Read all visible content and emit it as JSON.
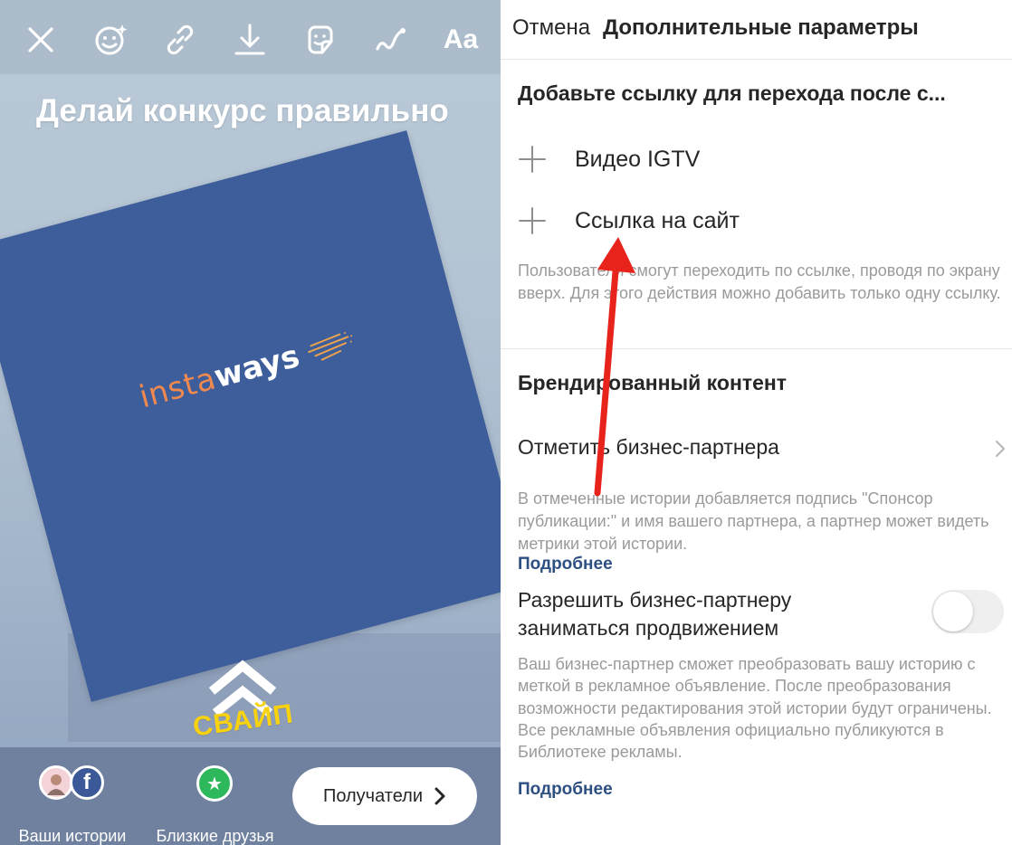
{
  "story": {
    "toolbar": {
      "close_icon": "close-icon",
      "face_effects_icon": "face-effects-icon",
      "link_icon": "link-icon",
      "download_icon": "download-icon",
      "sticker_icon": "sticker-icon",
      "draw_icon": "draw-icon",
      "text_tool_label": "Aa"
    },
    "heading": "Делай конкурс правильно",
    "logo": {
      "part1": "insta",
      "part2": "ways"
    },
    "swipe": {
      "arrow_icon": "double-chevron-up-icon",
      "label": "СВАЙП"
    },
    "bottom": {
      "your_stories_label": "Ваши истории",
      "close_friends_label": "Близкие друзья",
      "recipients_label": "Получатели"
    }
  },
  "settings": {
    "header": {
      "cancel_label": "Отмена",
      "title": "Дополнительные параметры"
    },
    "link_section": {
      "title": "Добавьте ссылку для перехода после с...",
      "igtv_label": "Видео IGTV",
      "website_label": "Ссылка на сайт",
      "hint": "Пользователи смогут переходить по ссылке, проводя по экрану вверх. Для этого действия можно добавить только одну ссылку."
    },
    "branded_section": {
      "title": "Брендированный контент",
      "tag_partner_label": "Отметить бизнес-партнера",
      "tag_partner_hint": "В отмеченные истории добавляется подпись \"Спонсор публикации:\" и имя вашего партнера, а партнер может видеть метрики этой истории.",
      "more_label_1": "Подробнее",
      "allow_promote_label": "Разрешить бизнес-партнеру заниматься продвижением",
      "allow_promote_enabled": false,
      "allow_promote_hint": "Ваш бизнес-партнер сможет преобразовать вашу историю с меткой в рекламное объявление. После преобразования возможности редактирования этой истории будут ограничены. Все рекламные объявления официально публикуются в Библиотеке рекламы.",
      "more_label_2": "Подробнее"
    }
  },
  "colors": {
    "card_blue": "#3e5e9b",
    "logo_orange": "#f0894f",
    "swipe_yellow": "#f9d20f",
    "link_blue": "#2d4f82",
    "annotation_red": "#e8231c"
  }
}
